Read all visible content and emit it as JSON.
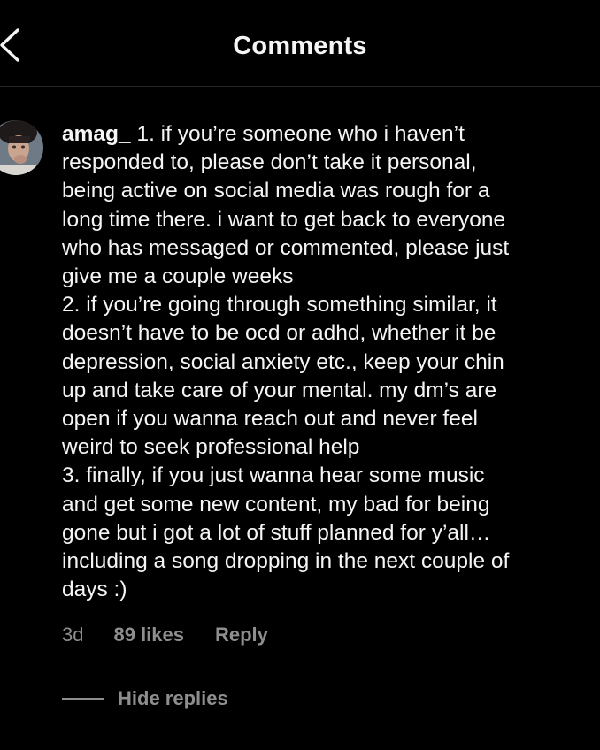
{
  "header": {
    "title": "Comments",
    "back_icon": "chevron-left-icon"
  },
  "comment": {
    "username": "amag_",
    "text_lines": [
      " 1. if you’re someone who i haven’t",
      "responded to, please don’t take it personal,",
      "being active on social media was rough for a",
      "long time there. i want to get back to everyone",
      "who has messaged or commented, please just",
      "give me a couple weeks",
      "2. if you’re going through something similar, it",
      "doesn’t have to be ocd or adhd, whether it be",
      "depression, social anxiety etc., keep your chin",
      "up and take care of your mental. my dm’s are",
      "open if you wanna reach out and never feel",
      "weird to seek professional help",
      "3. finally, if you just wanna hear some music",
      "and get some new content, my bad for being",
      "gone but i got a lot of stuff planned for y’all…",
      "including a song dropping in the next couple of",
      "days :)"
    ],
    "time": "3d",
    "likes": "89 likes",
    "reply_label": "Reply"
  },
  "replies": {
    "hide_label": "Hide replies"
  },
  "colors": {
    "background": "#000000",
    "text": "#f5f5f5",
    "secondary": "#8e8e8e",
    "divider": "#262626"
  }
}
